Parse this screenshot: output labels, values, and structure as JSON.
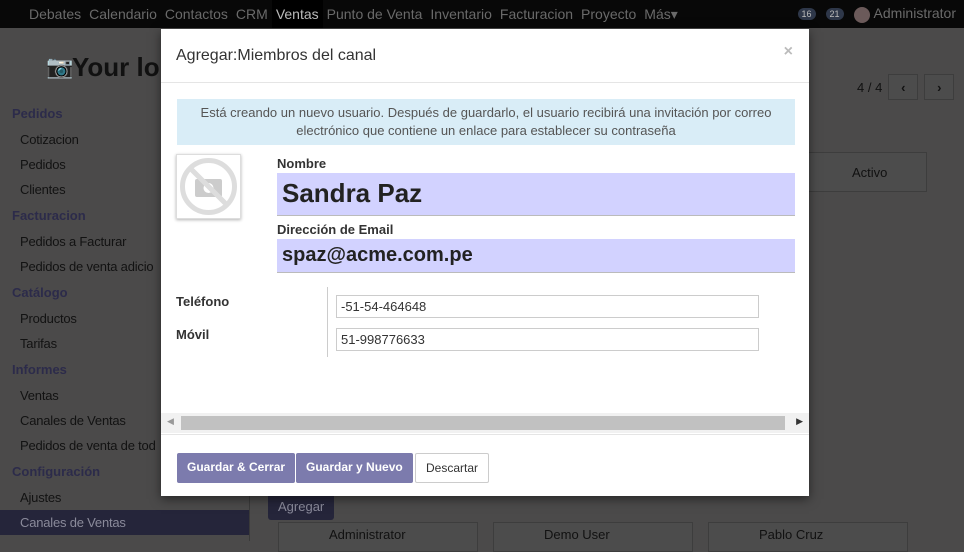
{
  "topnav": {
    "items": [
      "Debates",
      "Calendario",
      "Contactos",
      "CRM",
      "Ventas",
      "Punto de Venta",
      "Inventario",
      "Facturacion",
      "Proyecto",
      "Más▾"
    ],
    "badge1": "16",
    "badge2": "21",
    "user": "Administrator"
  },
  "page": {
    "title": "Your lo",
    "pager": "4 / 4",
    "activo": "Activo",
    "agregar": "Agregar",
    "cards": [
      "Administrator",
      "Demo User",
      "Pablo Cruz"
    ]
  },
  "sidebar": [
    {
      "h": "Pedidos",
      "items": [
        "Cotizacion",
        "Pedidos",
        "Clientes"
      ]
    },
    {
      "h": "Facturacion",
      "items": [
        "Pedidos a Facturar",
        "Pedidos de venta adicio"
      ]
    },
    {
      "h": "Catálogo",
      "items": [
        "Productos",
        "Tarifas"
      ]
    },
    {
      "h": "Informes",
      "items": [
        "Ventas",
        "Canales de Ventas",
        "Pedidos de venta de tod"
      ]
    },
    {
      "h": "Configuración",
      "items": [
        "Ajustes",
        "Canales de Ventas"
      ]
    }
  ],
  "modal": {
    "title": "Agregar:Miembros del canal",
    "close": "×",
    "alert": "Está creando un nuevo usuario. Después de guardarlo, el usuario recibirá una invitación por correo electrónico que contiene un enlace para establecer su contraseña",
    "name_label": "Nombre",
    "name": "Sandra Paz",
    "email_label": "Dirección de Email",
    "email": "spaz@acme.com.pe",
    "phone_label": "Teléfono",
    "phone": "-51-54-464648",
    "mobile_label": "Móvil",
    "mobile": "51-998776633",
    "save_close": "Guardar & Cerrar",
    "save_new": "Guardar y Nuevo",
    "discard": "Descartar"
  }
}
